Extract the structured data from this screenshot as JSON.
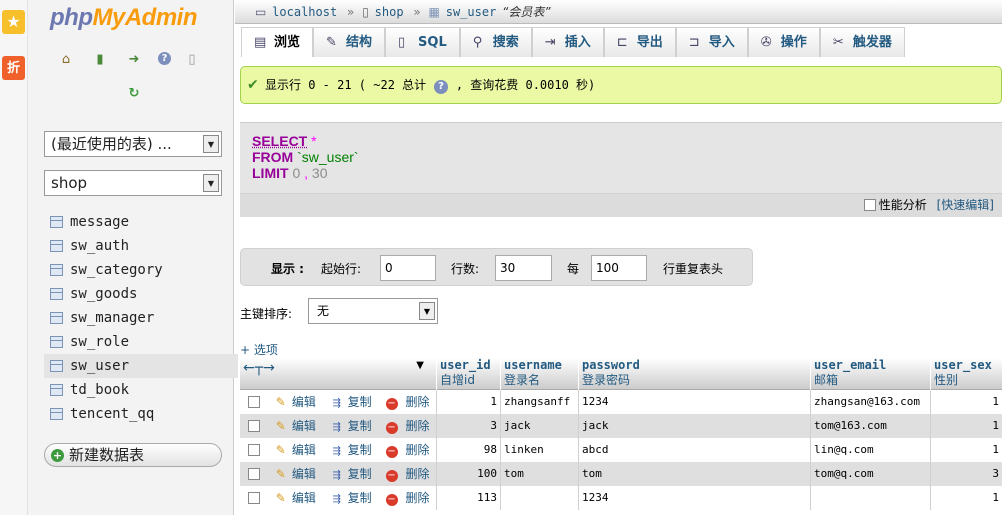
{
  "browser": {
    "favorite_icon": "star-icon",
    "discount_label": "折"
  },
  "nav": {
    "logo_php": "php",
    "logo_myadmin": "MyAdmin",
    "recent_tables": "(最近使用的表) ...",
    "database": "shop",
    "tables": [
      "message",
      "sw_auth",
      "sw_category",
      "sw_goods",
      "sw_manager",
      "sw_role",
      "sw_user",
      "td_book",
      "tencent_qq"
    ],
    "active_table": "sw_user",
    "new_table": "新建数据表"
  },
  "breadcrumb": {
    "server": "localhost",
    "db": "shop",
    "table": "sw_user",
    "table_comment": "“会员表”"
  },
  "tabs": [
    {
      "label": "浏览",
      "icon": "browse-icon"
    },
    {
      "label": "结构",
      "icon": "structure-icon"
    },
    {
      "label": "SQL",
      "icon": "sql-icon"
    },
    {
      "label": "搜索",
      "icon": "search-icon"
    },
    {
      "label": "插入",
      "icon": "insert-icon"
    },
    {
      "label": "导出",
      "icon": "export-icon"
    },
    {
      "label": "导入",
      "icon": "import-icon"
    },
    {
      "label": "操作",
      "icon": "wrench-icon"
    },
    {
      "label": "触发器",
      "icon": "trigger-icon"
    }
  ],
  "message": {
    "text1": "显示行 0 - 21 ( ~22 总计",
    "text2": ", 查询花费 0.0010 秒)"
  },
  "sql": {
    "select": "SELECT",
    "star": "*",
    "from": "FROM",
    "table": "`sw_user`",
    "limit": "LIMIT",
    "offset": "0",
    "comma": ",",
    "count": "30",
    "profiling": "性能分析",
    "quick_edit": "[快速编辑]"
  },
  "show": {
    "label": "显示 :",
    "start_label": "起始行:",
    "start_value": "0",
    "rows_label": "行数:",
    "rows_value": "30",
    "every_label": "每",
    "every_value": "100",
    "repeat_label": "行重复表头"
  },
  "pk_sort": {
    "label": "主键排序:",
    "value": "无"
  },
  "options_link": "+ 选项",
  "table": {
    "columns": [
      {
        "name": "user_id",
        "comment": "自增id"
      },
      {
        "name": "username",
        "comment": "登录名"
      },
      {
        "name": "password",
        "comment": "登录密码"
      },
      {
        "name": "user_email",
        "comment": "邮箱"
      },
      {
        "name": "user_sex",
        "comment": "性别"
      }
    ],
    "actions": {
      "edit": "编辑",
      "copy": "复制",
      "delete": "删除"
    },
    "rows": [
      {
        "user_id": "1",
        "username": "zhangsanff",
        "password": "1234",
        "user_email": "zhangsan@163.com",
        "user_sex": "1"
      },
      {
        "user_id": "3",
        "username": "jack",
        "password": "jack",
        "user_email": "tom@163.com",
        "user_sex": "1"
      },
      {
        "user_id": "98",
        "username": "linken",
        "password": "abcd",
        "user_email": "lin@q.com",
        "user_sex": "1"
      },
      {
        "user_id": "100",
        "username": "tom",
        "password": "tom",
        "user_email": "tom@q.com",
        "user_sex": "3"
      },
      {
        "user_id": "113",
        "username": "",
        "password": "1234",
        "user_email": "",
        "user_sex": "1"
      }
    ]
  }
}
